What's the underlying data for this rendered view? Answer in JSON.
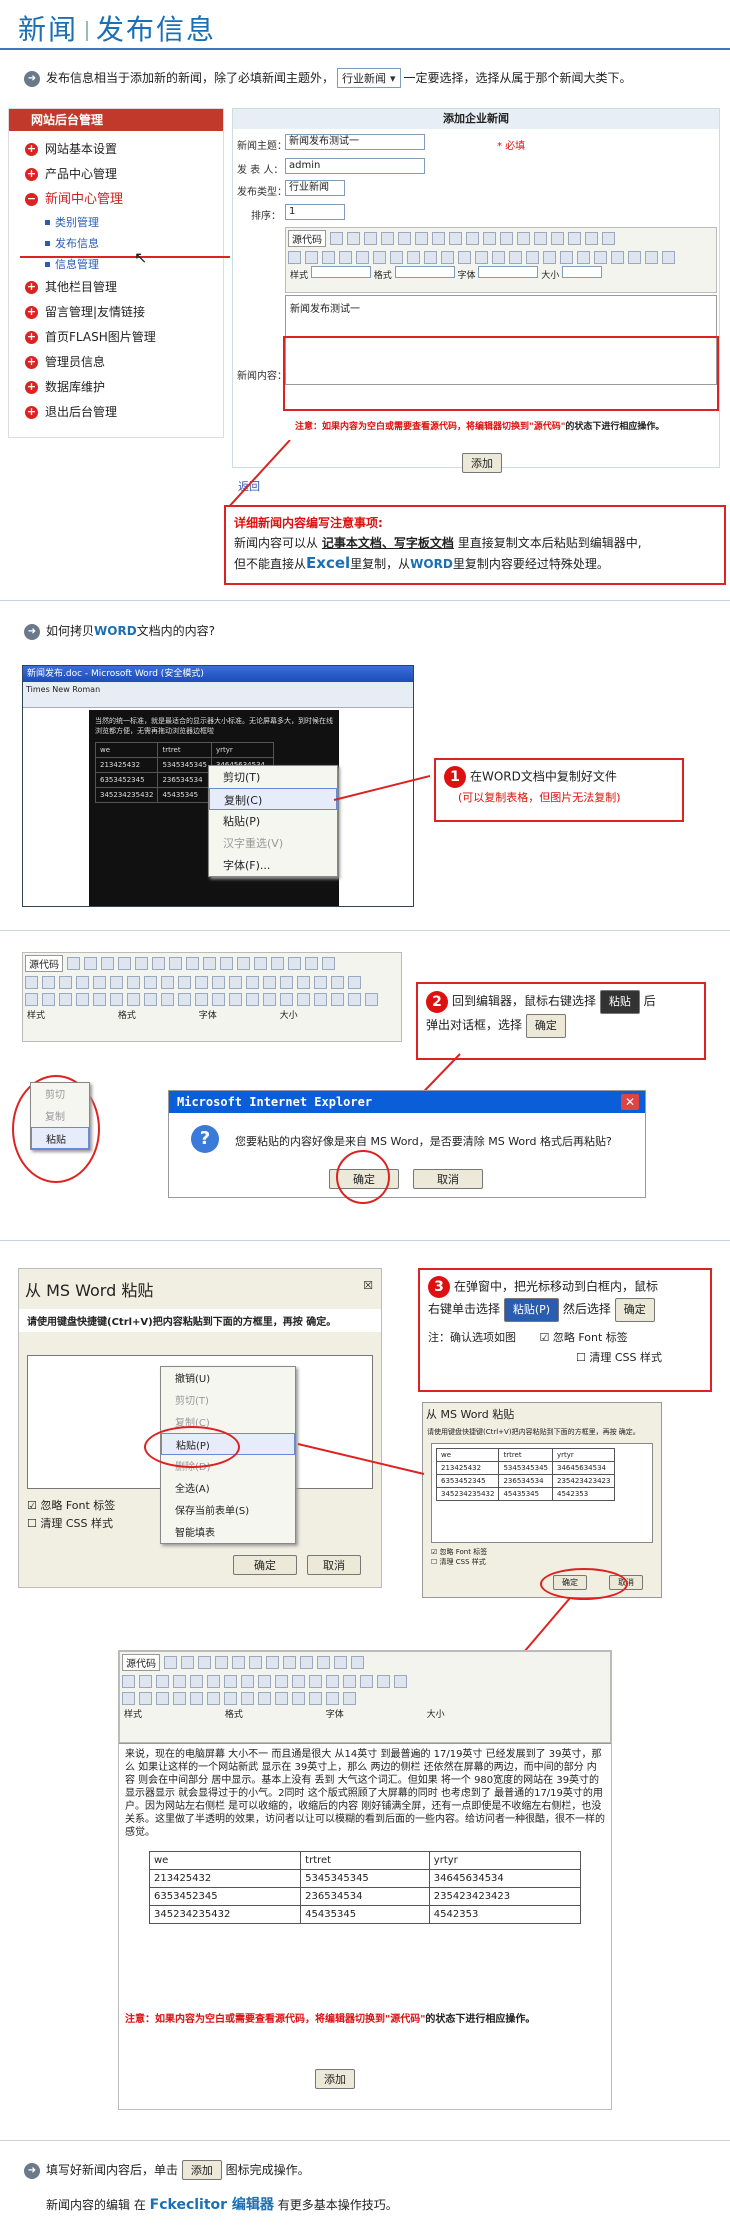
{
  "header": {
    "t1": "新闻",
    "t2": "发布信息"
  },
  "intro": {
    "a": "发布信息相当于添加新的新闻，除了必填新闻主题外，",
    "select": "行业新闻",
    "b": "一定要选择，选择从属于那个新闻大类下。"
  },
  "sidebar": {
    "title": "网站后台管理",
    "items": [
      "网站基本设置",
      "产品中心管理",
      "新闻中心管理",
      "类别管理",
      "发布信息",
      "信息管理",
      "其他栏目管理",
      "留言管理|友情链接",
      "首页FLASH图片管理",
      "管理员信息",
      "数据库维护",
      "退出后台管理"
    ]
  },
  "form": {
    "title": "添加企业新闻",
    "l_subject": "新闻主题：",
    "subject": "新闻发布测试一",
    "required": "* 必填",
    "l_author": "发 表 人：",
    "author": "admin",
    "l_type": "发布类型：",
    "type": "行业新闻",
    "l_order": "排序：",
    "order": "1",
    "l_content": "新闻内容：",
    "content": "新闻发布测试一",
    "src": "源代码",
    "f_style": "样式",
    "f_format": "格式",
    "f_font": "字体",
    "f_size": "大小",
    "warn": "注意：如果内容为空白或需要查看源代码，将编辑器切换到",
    "warn_code": "\"源代码\"",
    "warn_b": "的状态下进行相应操作。",
    "add": "添加",
    "back": "返回"
  },
  "note1": {
    "h": "详细新闻内容编写注意事项:",
    "l1a": "新闻内容可以从",
    "l1b": "记事本文档、写字板文档",
    "l1c": "里直接复制文本后粘贴到编辑器中,",
    "l2a": "但不能直接从",
    "l2b": "Excel",
    "l2c": "里复制，从",
    "l2d": "WORD",
    "l2e": "里复制内容要经过特殊处理。"
  },
  "q2": {
    "a": "如何拷贝",
    "b": "WORD",
    "c": "文档内的内容?"
  },
  "word": {
    "title": "新闻发布.doc - Microsoft Word (安全模式)",
    "font": "Times New Roman",
    "text": "当然的统一标准，就是最适合的显示器大小标准。无论屏幕多大，到时候在线浏览都方便，无需再拖动浏览器边框啦",
    "cells": [
      [
        "we",
        "trtret",
        "yrtyr"
      ],
      [
        "213425432",
        "5345345345",
        "34645634534"
      ],
      [
        "6353452345",
        "236534534",
        "235423423423"
      ],
      [
        "345234235432",
        "45435345",
        "4542353"
      ]
    ],
    "menu": [
      "剪切(T)",
      "复制(C)",
      "粘贴(P)",
      "汉字重选(V)",
      "字体(F)..."
    ]
  },
  "step1": {
    "num": "1",
    "a": "在WORD文档中复制好文件",
    "b": "(可以复制表格，但图片无法复制)"
  },
  "step2": {
    "num": "2",
    "a": "回到编辑器，鼠标右键选择",
    "paste": "粘贴",
    "b": "后",
    "c": "弹出对话框，选择",
    "ok": "确定"
  },
  "ie": {
    "title": "Microsoft Internet Explorer",
    "msg": "您要粘贴的内容好像是来自 MS Word，是否要清除 MS Word 格式后再粘贴?",
    "ok": "确定",
    "cancel": "取消",
    "m_cut": "剪切",
    "m_copy": "复制",
    "m_paste": "粘贴"
  },
  "msword": {
    "title": "从 MS Word 粘贴",
    "desc": "请使用键盘快捷键(Ctrl+V)把内容粘贴到下面的方框里，再按 确定。",
    "cb1": "忽略 Font 标签",
    "cb2": "清理 CSS 样式",
    "ok": "确定",
    "cancel": "取消",
    "menu": [
      "撤销(U)",
      "剪切(T)",
      "复制(C)",
      "粘贴(P)",
      "删除(D)",
      "全选(A)",
      "保存当前表单(S)",
      "智能填表"
    ]
  },
  "step3": {
    "num": "3",
    "a": "在弹窗中，把光标移动到白框内，鼠标",
    "b": "右键单击选择",
    "paste": "粘贴(P)",
    "c": "然后选择",
    "ok": "确定",
    "note": "注：确认选项如图",
    "cb1": "忽略 Font 标签",
    "cb2": "清理 CSS 样式"
  },
  "result": {
    "text": "来说，现在的电脑屏幕 大小不一 而且通是很大 从14英寸 到最普遍的 17/19英寸 已经发展到了 39英寸，那么 如果让这样的一个网站新武 显示在 39英寸上，那么 两边的侧栏 还依然在屏幕的两边，而中间的部分 内容 则会在中间部分 居中显示。基本上没有 丢到 大气这个词汇。但如果 将一个 980宽度的网站在 39英寸的显示器显示 就会显得过于的小气。2同时 这个版式照顾了大屏幕的同时 也考虑到了 最普通的17/19英寸的用户。因为网站左右侧栏 是可以收缩的，收缩后的内容 刚好铺满全屏，还有一点即使是不收缩左右侧栏，也没关系。这里做了半透明的效果，访问者以让可以模糊的看到后面的一些内容。给访问者一种很酷，很不一样的感觉。"
  },
  "final": {
    "a": "填写好新闻内容后，单击",
    "add": "添加",
    "b": "图标完成操作。",
    "c": "新闻内容的编辑 在",
    "d": "Fckeclitor 编辑器",
    "e": "有更多基本操作技巧。"
  }
}
